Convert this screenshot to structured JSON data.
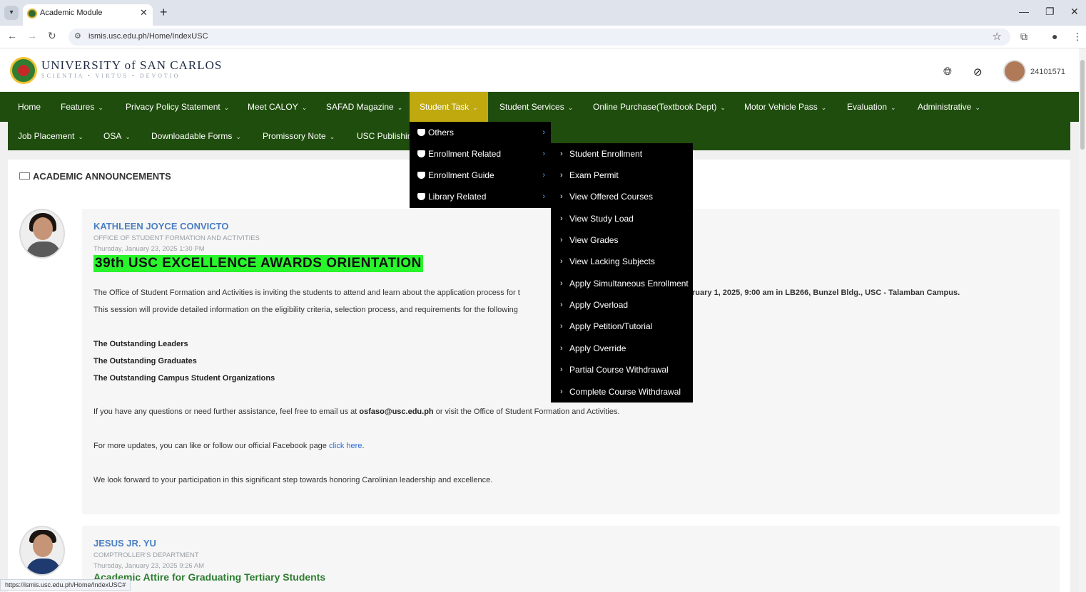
{
  "browser": {
    "tab_title": "Academic Module",
    "tab_close": "✕",
    "new_tab": "+",
    "url": "ismis.usc.edu.ph/Home/IndexUSC",
    "status_url": "https://ismis.usc.edu.ph/Home/IndexUSC#"
  },
  "header": {
    "university_name": "UNIVERSITY of SAN CARLOS",
    "motto": "SCIENTIA • VIRTUS • DEVOTIO",
    "user_id": "24101571"
  },
  "nav": {
    "main": [
      {
        "label": "Home",
        "caret": false
      },
      {
        "label": "Features",
        "caret": true
      },
      {
        "label": "Privacy Policy Statement",
        "caret": true
      },
      {
        "label": "Meet CALOY",
        "caret": true
      },
      {
        "label": "SAFAD Magazine",
        "caret": true
      },
      {
        "label": "Student Task",
        "caret": true,
        "active": true
      },
      {
        "label": "Student Services",
        "caret": true
      },
      {
        "label": "Online Purchase(Textbook Dept)",
        "caret": true
      },
      {
        "label": "Motor Vehicle Pass",
        "caret": true
      },
      {
        "label": "Evaluation",
        "caret": true
      },
      {
        "label": "Administrative",
        "caret": true
      }
    ],
    "sub": [
      {
        "label": "Job Placement",
        "caret": true
      },
      {
        "label": "OSA",
        "caret": true
      },
      {
        "label": "Downloadable Forms",
        "caret": true
      },
      {
        "label": "Promissory Note",
        "caret": true
      },
      {
        "label": "USC Publishing",
        "caret": false
      }
    ],
    "caret_glyph": "⌄"
  },
  "student_task_menu": {
    "items": [
      "Others",
      "Enrollment Related",
      "Enrollment Guide",
      "Library Related"
    ],
    "arrow": "›",
    "enrollment_related": [
      "Student Enrollment",
      "Exam Permit",
      "View Offered Courses",
      "View Study Load",
      "View Grades",
      "View Lacking Subjects",
      "Apply Simultaneous Enrollment",
      "Apply Overload",
      "Apply Petition/Tutorial",
      "Apply Override",
      "Partial Course Withdrawal",
      "Complete Course Withdrawal"
    ]
  },
  "announcements": {
    "title": "ACADEMIC ANNOUNCEMENTS",
    "posts": [
      {
        "author": "KATHLEEN JOYCE CONVICTO",
        "department": "OFFICE OF STUDENT FORMATION AND ACTIVITIES",
        "date": "Thursday, January 23, 2025 1:30 PM",
        "headline": "39th USC EXCELLENCE AWARDS ORIENTATION",
        "p1_left": "The Office of Student Formation and Activities is inviting the students to attend and learn about the application process for t",
        "p1_right": "ruary 1, 2025, 9:00 am in LB266, Bunzel Bldg., USC - Talamban Campus.",
        "p2": "This session will provide detailed information on the eligibility criteria, selection process, and requirements for the following",
        "awards": [
          "The Outstanding Leaders",
          "The Outstanding Graduates",
          "The Outstanding Campus Student Organizations"
        ],
        "p3_before": "If you have any questions or need further assistance, feel free to email us at ",
        "p3_email": "osfaso@usc.edu.ph",
        "p3_after": " or visit the Office of Student Formation and Activities.",
        "p4_before": "For more updates, you can like or follow our official Facebook page ",
        "p4_link": "click here",
        "p4_after": ".",
        "p5": "We look forward to your participation in this significant step towards honoring Carolinian leadership and excellence."
      },
      {
        "author": "JESUS JR. YU",
        "department": "COMPTROLLER'S DEPARTMENT",
        "date": "Thursday, January 23, 2025 9:26 AM",
        "headline": "Academic Attire for Graduating Tertiary Students"
      }
    ]
  },
  "colors": {
    "nav_green": "#1f4d0d",
    "active_gold": "#bfa90f",
    "headline_green": "#28f52b",
    "author_blue": "#4a7fc1"
  }
}
